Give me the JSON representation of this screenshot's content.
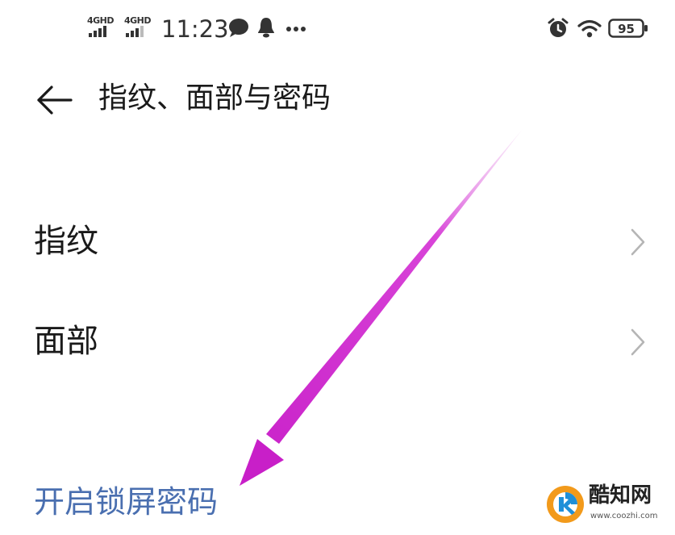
{
  "status_bar": {
    "sim1_label": "4GHD",
    "sim2_label": "4GHD",
    "time": "11:23",
    "battery": "95",
    "icons": [
      "signal-icon",
      "message-icon",
      "notification-icon",
      "more-icon",
      "alarm-icon",
      "wifi-icon",
      "battery-icon"
    ]
  },
  "header": {
    "title": "指纹、面部与密码"
  },
  "list": {
    "items": [
      {
        "label": "指纹"
      },
      {
        "label": "面部"
      }
    ]
  },
  "lock_screen_link": "开启锁屏密码",
  "watermark": {
    "name": "酷知网",
    "url": "www.coozhi.com"
  },
  "colors": {
    "link": "#4a6fb0",
    "annotation_arrow": "#cc22cc",
    "watermark_orange": "#f29a1b",
    "watermark_blue": "#1f8fd8"
  }
}
